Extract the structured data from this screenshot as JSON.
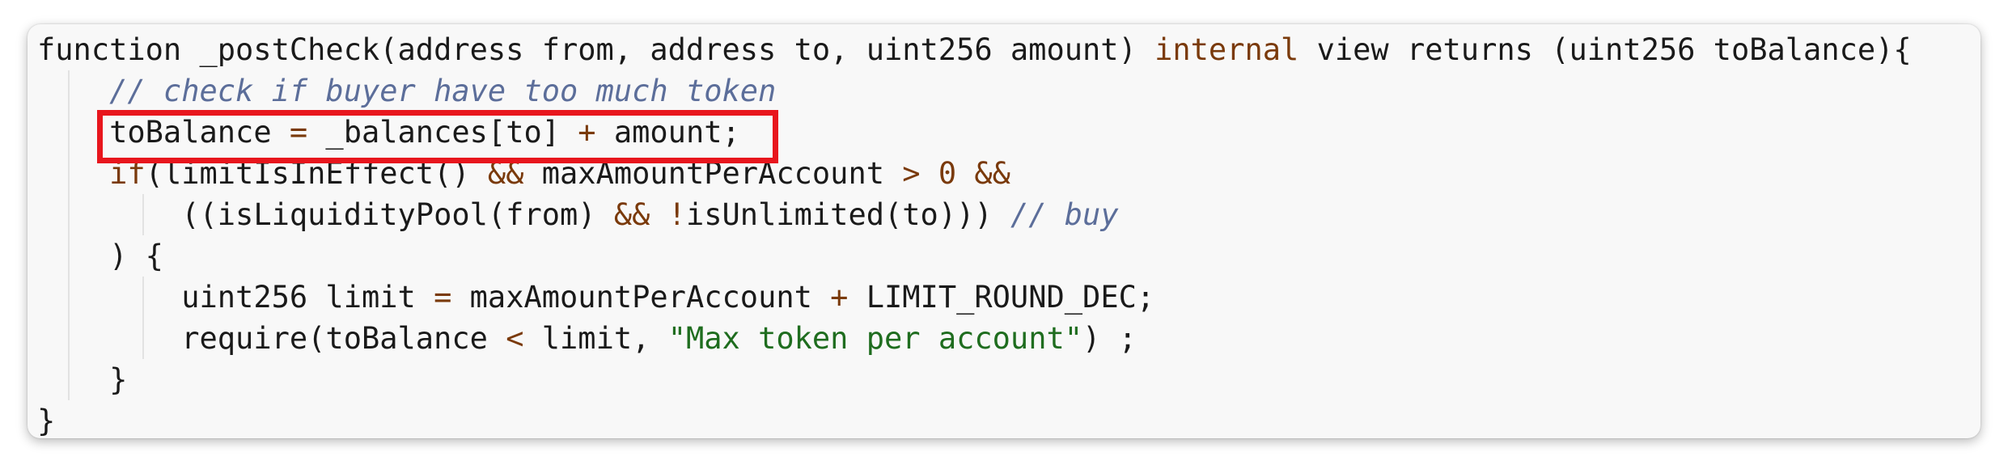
{
  "code": {
    "line1": {
      "a": "function _postCheck(address from, address to, uint256 amount) ",
      "kw_internal": "internal",
      "b": " view returns (uint256 toBalance){"
    },
    "line2": {
      "comment": "// check if buyer have too much token"
    },
    "line3": {
      "a": "toBalance ",
      "op_eq": "=",
      "b": " _balances[to] ",
      "op_plus": "+",
      "c": " amount;"
    },
    "line4": {
      "kw_if": "if",
      "a": "(limitIsInEffect() ",
      "op_and": "&&",
      "b": " maxAmountPerAccount ",
      "op_gt": ">",
      "num": " 0 ",
      "op_and2": "&&"
    },
    "line5": {
      "a": "((isLiquidityPool(from) ",
      "op_and": "&&",
      "op_not": " !",
      "b": "isUnlimited(to))) ",
      "comment": "// buy"
    },
    "line6": {
      "a": ") {"
    },
    "line7": {
      "a": "uint256 limit ",
      "op_eq": "=",
      "b": " maxAmountPerAccount ",
      "op_plus": "+",
      "c": " LIMIT_ROUND_DEC;"
    },
    "line8": {
      "a": "require(toBalance ",
      "op_lt": "<",
      "b": " limit, ",
      "str": "\"Max token per account\"",
      "c": ") ;"
    },
    "line9": {
      "a": "}"
    },
    "line10": {
      "a": "}"
    }
  },
  "colors": {
    "highlight_box": "#e8161d",
    "keyword": "#7a3a0b",
    "comment": "#5c6e9a",
    "string": "#1f6d1f"
  }
}
